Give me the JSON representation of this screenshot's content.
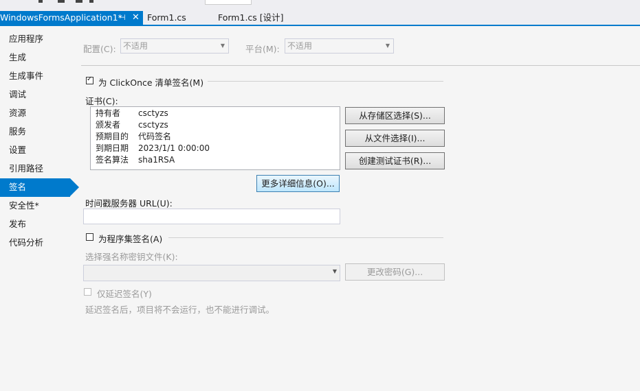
{
  "tabs": [
    {
      "label": "WindowsFormsApplication1*",
      "active": true,
      "pin_icon": "pin-icon",
      "close_icon": "close-icon"
    },
    {
      "label": "Form1.cs"
    },
    {
      "label": "Form1.cs [设计]"
    }
  ],
  "sidebar": {
    "selected": "签名",
    "items": [
      "应用程序",
      "生成",
      "生成事件",
      "调试",
      "资源",
      "服务",
      "设置",
      "引用路径",
      "签名",
      "安全性*",
      "发布",
      "代码分析"
    ]
  },
  "config": {
    "config_label": "配置(C):",
    "config_value": "不适用",
    "platform_label": "平台(M):",
    "platform_value": "不适用"
  },
  "clickonce": {
    "checkbox_label": "为 ClickOnce 清单签名(M)",
    "checked": true,
    "cert_label": "证书(C):",
    "cert_rows": [
      {
        "key": "持有者",
        "value": "csctyzs"
      },
      {
        "key": "颁发者",
        "value": "csctyzs"
      },
      {
        "key": "预期目的",
        "value": "代码签名"
      },
      {
        "key": "到期日期",
        "value": "2023/1/1 0:00:00"
      },
      {
        "key": "签名算法",
        "value": "sha1RSA"
      }
    ],
    "btn_store": "从存储区选择(S)...",
    "btn_file": "从文件选择(I)...",
    "btn_test_cert": "创建测试证书(R)...",
    "btn_more": "更多详细信息(O)...",
    "timestamp_label": "时间戳服务器 URL(U):",
    "timestamp_value": ""
  },
  "assembly": {
    "checkbox_label": "为程序集签名(A)",
    "checked": false,
    "key_file_label": "选择强名称密钥文件(K):",
    "key_file_value": "",
    "btn_change_password": "更改密码(G)...",
    "delay_sign_label": "仅延迟签名(Y)",
    "delay_note": "延迟签名后，项目将不会运行，也不能进行调试。"
  }
}
